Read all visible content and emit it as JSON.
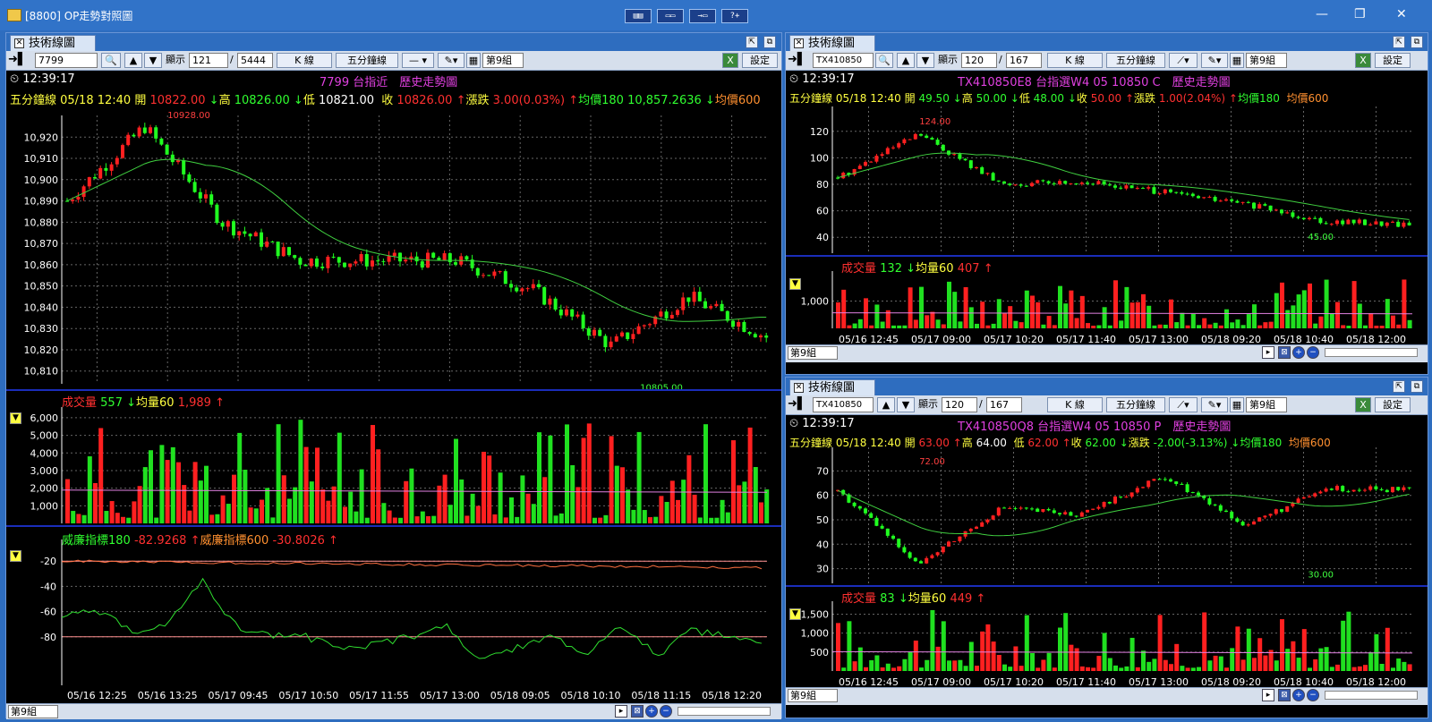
{
  "window": {
    "title": "[8800] OP走勢對照圖",
    "toolbar_icons": [
      "layout-1-icon",
      "layout-2-icon",
      "layout-3-icon",
      "layout-4-icon"
    ]
  },
  "common": {
    "tab_label": "技術線圖",
    "display_label": "顯示",
    "kline_label": "K 線",
    "period_label": "五分鐘線",
    "group_label": "第9組",
    "settings_label": "設定",
    "vol_label": "成交量",
    "avgvol_label": "均量60",
    "time": "12:39:17"
  },
  "panel_left": {
    "symbol": "7799",
    "display_count": "121",
    "total": "5444",
    "title": "7799 台指近　歷史走勢圖",
    "ohlc": {
      "prefix": "五分鐘線 05/18 12:40",
      "open_label": "開",
      "open": "10822.00",
      "high_label": "高",
      "high": "10826.00",
      "low_label": "低",
      "low": "10821.00",
      "close_label": "收",
      "close": "10826.00",
      "chg_label": "漲跌",
      "chg": "3.00(0.03%)",
      "ma1_label": "均價180",
      "ma1": "10,857.2636",
      "ma2_label": "均價600"
    },
    "yticks": [
      "10,920",
      "10,910",
      "10,900",
      "10,890",
      "10,880",
      "10,870",
      "10,860",
      "10,850",
      "10,840",
      "10,830",
      "10,820",
      "10,810"
    ],
    "hi_mark": "10928.00",
    "lo_mark": "10805.00",
    "vol": "557",
    "avgvol": "1,989",
    "vol_ticks": [
      "6,000",
      "5,000",
      "4,000",
      "3,000",
      "2,000",
      "1,000"
    ],
    "wr_label1": "威廉指標180",
    "wr1": "-82.9268",
    "wr_label2": "威廉指標600",
    "wr2": "-30.8026",
    "wr_ticks": [
      "-20",
      "-40",
      "-60",
      "-80"
    ],
    "xticks": [
      "05/16 12:25",
      "05/16 13:25",
      "05/17 09:45",
      "05/17 10:50",
      "05/17 11:55",
      "05/17 13:00",
      "05/18 09:05",
      "05/18 10:10",
      "05/18 11:15",
      "05/18 12:20"
    ]
  },
  "panel_rt": {
    "symbol": "TX410850",
    "display_count": "120",
    "total": "167",
    "title": "TX410850E8 台指選W4 05 10850 C　歷史走勢圖",
    "ohlc": {
      "prefix": "五分鐘線 05/18 12:40",
      "open_label": "開",
      "open": "49.50",
      "high_label": "高",
      "high": "50.00",
      "low_label": "低",
      "low": "48.00",
      "close_label": "收",
      "close": "50.00",
      "chg_label": "漲跌",
      "chg": "1.00(2.04%)",
      "ma1_label": "均價180",
      "ma2_label": "均價600"
    },
    "yticks": [
      "120",
      "100",
      "80",
      "60",
      "40"
    ],
    "hi_mark": "124.00",
    "lo_mark": "45.00",
    "vol": "132",
    "avgvol": "407",
    "vol_ticks": [
      "1,000"
    ],
    "xticks": [
      "05/16 12:45",
      "05/17 09:00",
      "05/17 10:20",
      "05/17 11:40",
      "05/17 13:00",
      "05/18 09:20",
      "05/18 10:40",
      "05/18 12:00"
    ]
  },
  "panel_rb": {
    "symbol": "TX410850",
    "display_count": "120",
    "total": "167",
    "title": "TX410850Q8 台指選W4 05 10850 P　歷史走勢圖",
    "ohlc": {
      "prefix": "五分鐘線 05/18 12:40",
      "open_label": "開",
      "open": "63.00",
      "high_label": "高",
      "high": "64.00",
      "low_label": "低",
      "low": "62.00",
      "close_label": "收",
      "close": "62.00",
      "chg_label": "漲跌",
      "chg": "-2.00(-3.13%)",
      "ma1_label": "均價180",
      "ma2_label": "均價600"
    },
    "yticks": [
      "70",
      "60",
      "50",
      "40",
      "30"
    ],
    "hi_mark": "72.00",
    "lo_mark": "30.00",
    "vol": "83",
    "avgvol": "449",
    "vol_ticks": [
      "1,500",
      "1,000",
      "500"
    ],
    "xticks": [
      "05/16 12:45",
      "05/17 09:00",
      "05/17 10:20",
      "05/17 11:40",
      "05/17 13:00",
      "05/18 09:20",
      "05/18 10:40",
      "05/18 12:00"
    ]
  },
  "chart_data": [
    {
      "type": "line",
      "title": "7799 台指近 歷史走勢圖",
      "xlabel": "",
      "ylabel": "",
      "ylim": [
        10805,
        10928
      ],
      "x": [
        "05/16 12:25",
        "05/16 13:25",
        "05/17 09:45",
        "05/17 10:50",
        "05/17 11:55",
        "05/17 13:00",
        "05/18 09:05",
        "05/18 10:10",
        "05/18 11:15",
        "05/18 12:20"
      ],
      "series": [
        {
          "values": [
            10890,
            10925,
            10880,
            10862,
            10862,
            10862,
            10848,
            10822,
            10845,
            10826
          ]
        }
      ]
    },
    {
      "type": "line",
      "title": "TX410850E8 台指選W4 05 10850 C 歷史走勢圖",
      "xlabel": "",
      "ylabel": "",
      "ylim": [
        45,
        124
      ],
      "x": [
        "05/16 12:45",
        "05/17 09:00",
        "05/17 10:20",
        "05/17 11:40",
        "05/17 13:00",
        "05/18 09:20",
        "05/18 10:40",
        "05/18 12:00"
      ],
      "series": [
        {
          "values": [
            85,
            118,
            80,
            82,
            74,
            65,
            52,
            50
          ]
        }
      ]
    },
    {
      "type": "line",
      "title": "TX410850Q8 台指選W4 05 10850 P 歷史走勢圖",
      "xlabel": "",
      "ylabel": "",
      "ylim": [
        30,
        72
      ],
      "x": [
        "05/16 12:45",
        "05/17 09:00",
        "05/17 10:20",
        "05/17 11:40",
        "05/17 13:00",
        "05/18 09:20",
        "05/18 10:40",
        "05/18 12:00"
      ],
      "series": [
        {
          "values": [
            62,
            32,
            55,
            52,
            68,
            48,
            63,
            62
          ]
        }
      ]
    }
  ]
}
